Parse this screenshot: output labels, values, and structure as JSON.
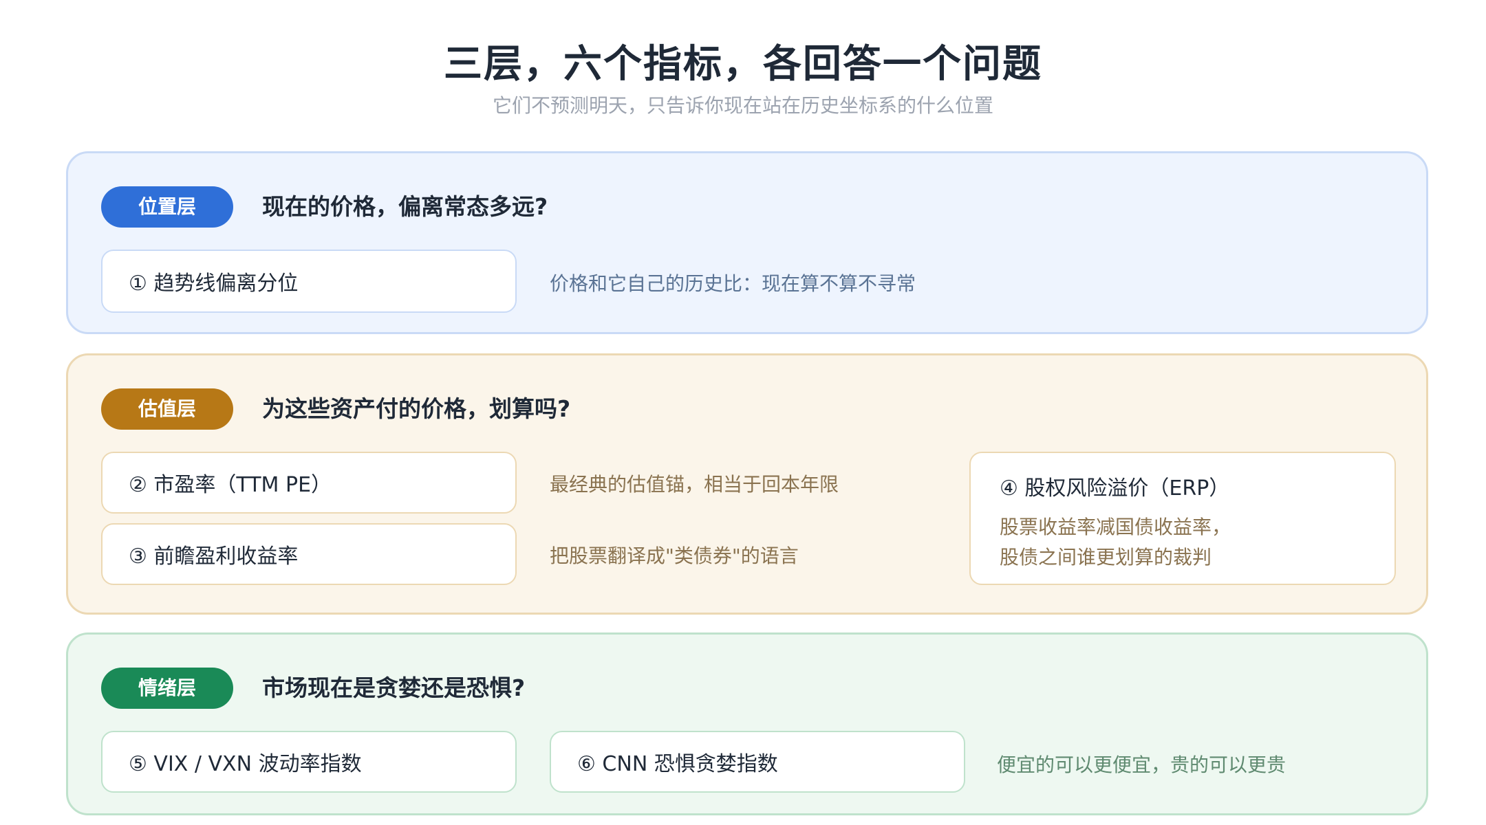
{
  "title": "三层，六个指标，各回答一个问题",
  "subtitle": "它们不预测明天，只告诉你现在站在历史坐标系的什么位置",
  "layers": [
    {
      "badge": "位置层",
      "question": "现在的价格，偏离常态多远?",
      "color": "#2f6fd8",
      "indicators": [
        {
          "label": "① 趋势线偏离分位",
          "desc": "价格和它自己的历史比：现在算不算不寻常"
        }
      ]
    },
    {
      "badge": "估值层",
      "question": "为这些资产付的价格，划算吗?",
      "color": "#b77816",
      "indicators": [
        {
          "label": "② 市盈率（TTM PE）",
          "desc": "最经典的估值锚，相当于回本年限"
        },
        {
          "label": "③ 前瞻盈利收益率",
          "desc": "把股票翻译成\"类债券\"的语言"
        },
        {
          "label": "④ 股权风险溢价（ERP）",
          "desc_lines": [
            "股票收益率减国债收益率，",
            "股债之间谁更划算的裁判"
          ]
        }
      ]
    },
    {
      "badge": "情绪层",
      "question": "市场现在是贪婪还是恐惧?",
      "color": "#1a8a57",
      "indicators": [
        {
          "label": "⑤ VIX / VXN 波动率指数"
        },
        {
          "label": "⑥ CNN 恐惧贪婪指数"
        }
      ],
      "desc": "便宜的可以更便宜，贵的可以更贵"
    }
  ]
}
